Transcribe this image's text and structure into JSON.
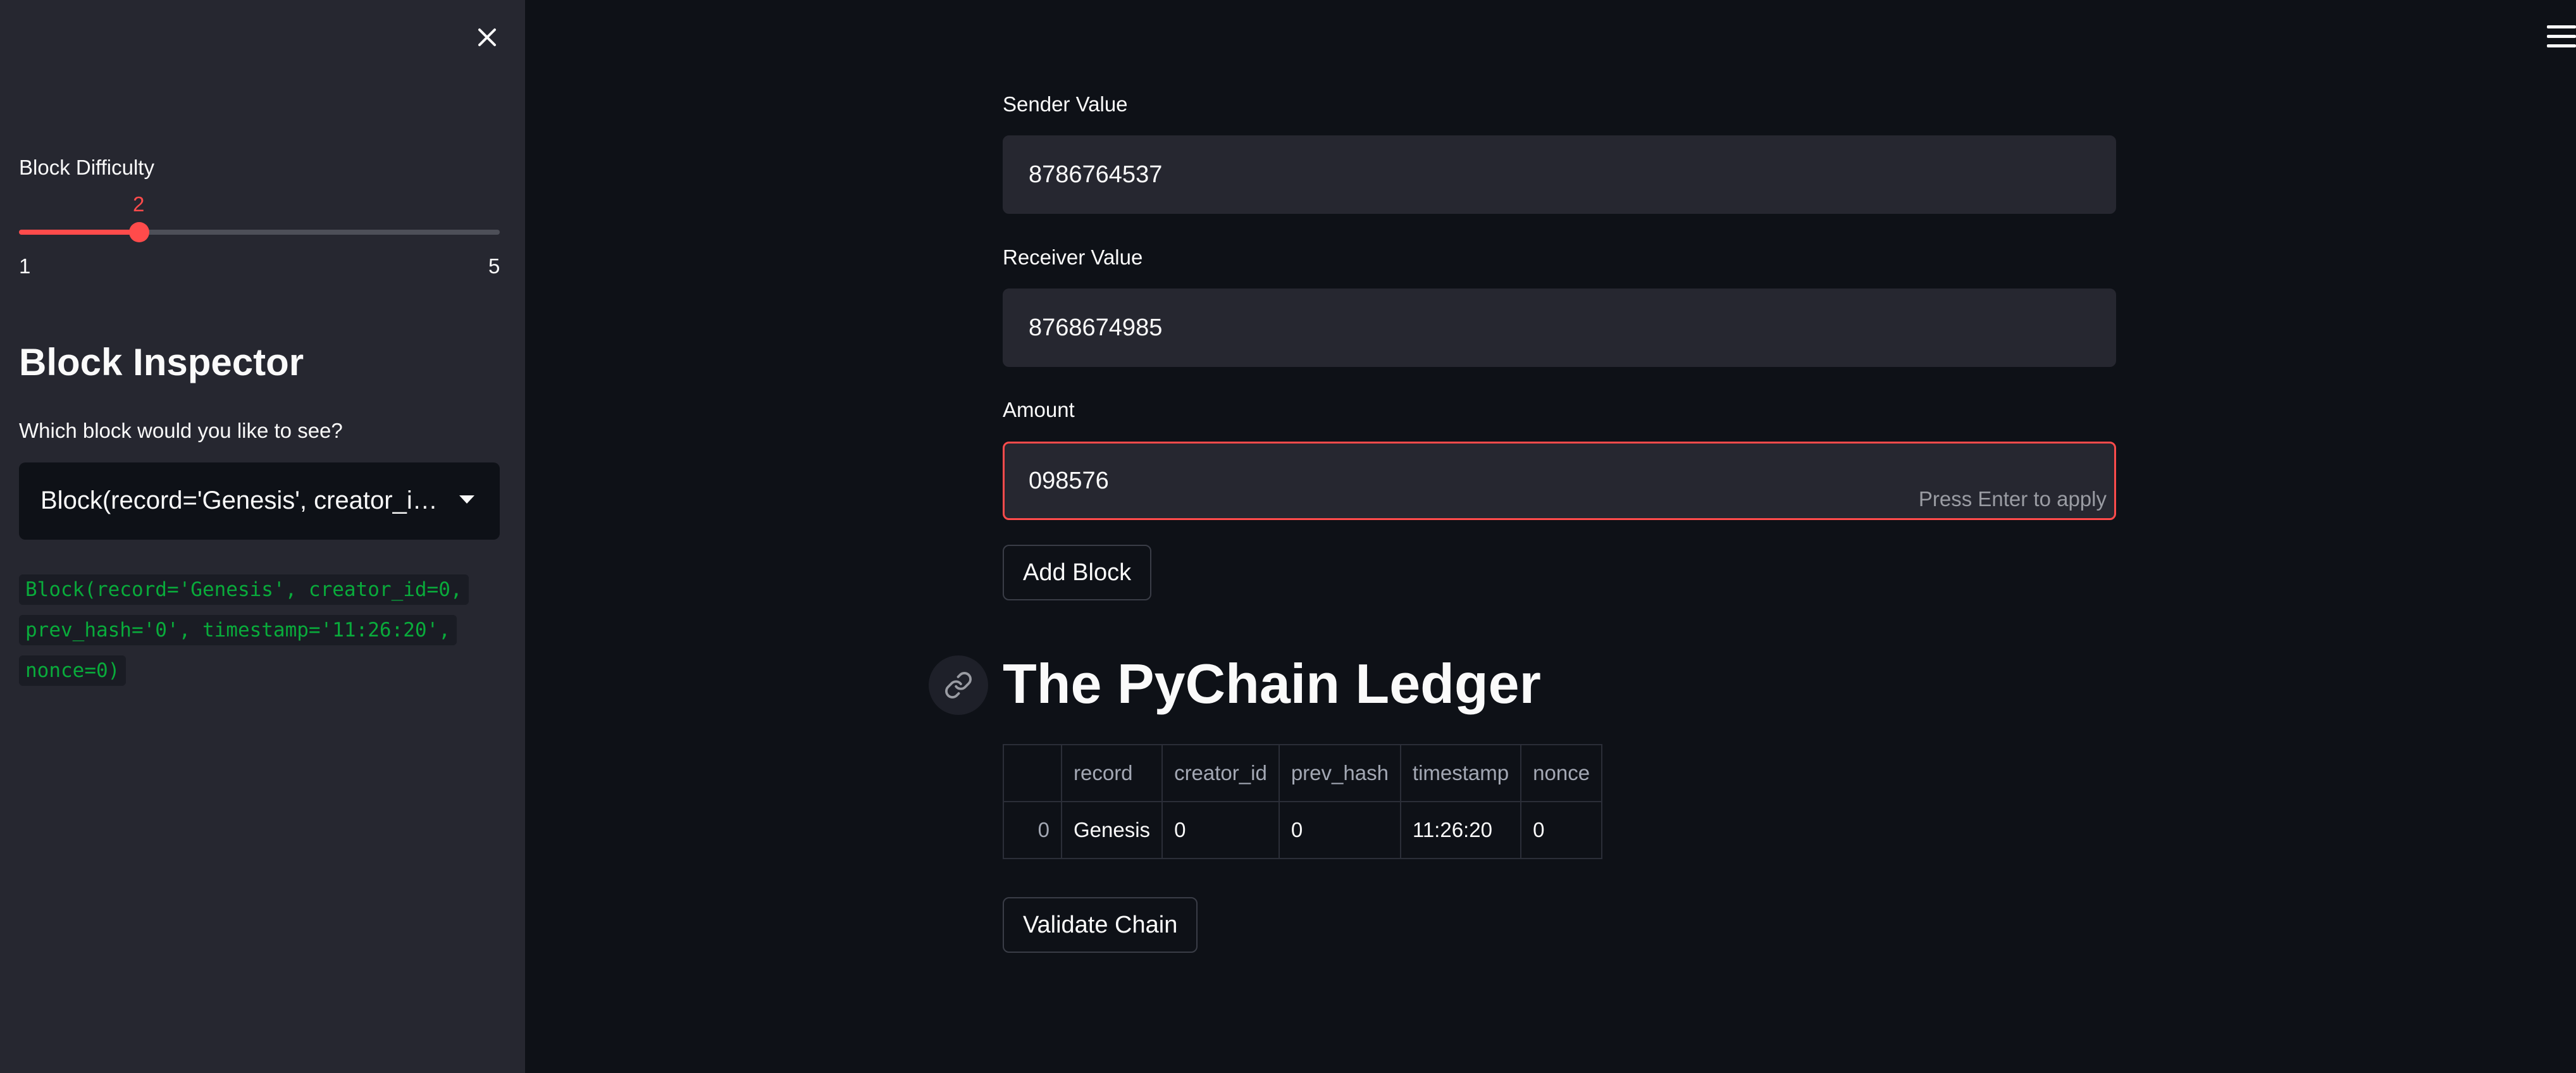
{
  "sidebar": {
    "close_icon": "close-icon",
    "slider": {
      "label": "Block Difficulty",
      "value": 2,
      "value_text": "2",
      "min": 1,
      "max": 5,
      "min_text": "1",
      "max_text": "5",
      "accent_color": "#ff4b4b"
    },
    "inspector": {
      "title": "Block Inspector",
      "select_label": "Which block would you like to see?",
      "selected_value": "Block(record='Genesis', creator_id=0, prev_hash='0', timestamp='11:26:20', nonce=0)",
      "code_lines": [
        "Block(record='Genesis', creator_id=0,",
        "prev_hash='0', timestamp='11:26:20',",
        "nonce=0)"
      ]
    }
  },
  "main": {
    "menu_icon": "hamburger-menu-icon",
    "sender": {
      "label": "Sender Value",
      "value": "8786764537"
    },
    "receiver": {
      "label": "Receiver Value",
      "value": "8768674985"
    },
    "amount": {
      "label": "Amount",
      "value": "098576",
      "hint": "Press Enter to apply"
    },
    "add_block_label": "Add Block",
    "ledger_title": "The PyChain Ledger",
    "table": {
      "columns": [
        "",
        "record",
        "creator_id",
        "prev_hash",
        "timestamp",
        "nonce"
      ],
      "rows": [
        [
          "0",
          "Genesis",
          "0",
          "0",
          "11:26:20",
          "0"
        ]
      ]
    },
    "validate_label": "Validate Chain"
  },
  "colors": {
    "background": "#0e1117",
    "sidebar_background": "#262730",
    "accent": "#ff4b4b",
    "code_text": "#09ab3b"
  }
}
